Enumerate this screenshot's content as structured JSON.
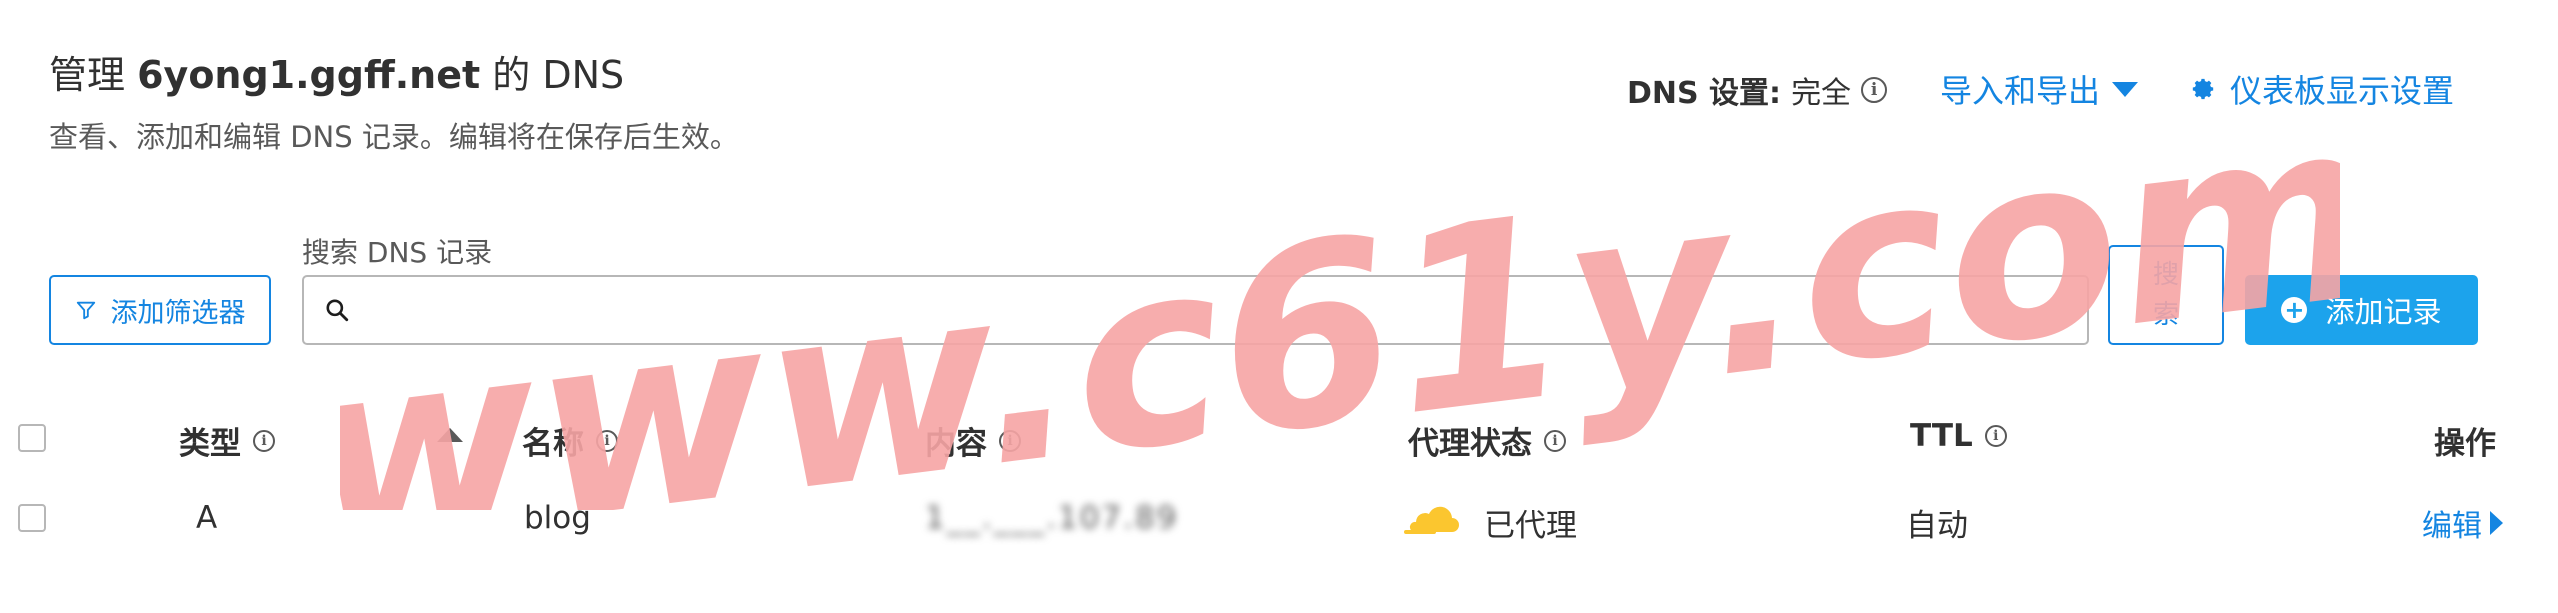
{
  "header": {
    "title_prefix": "管理",
    "domain": "6yong1.ggff.net",
    "title_suffix": "的 DNS",
    "subtitle": "查看、添加和编辑 DNS 记录。编辑将在保存后生效。"
  },
  "top_actions": {
    "dns_setting_label": "DNS 设置:",
    "dns_setting_value": "完全",
    "import_export": "导入和导出",
    "dashboard_settings": "仪表板显示设置"
  },
  "toolbar": {
    "filter_button": "添加筛选器",
    "search_label": "搜索 DNS 记录",
    "search_value": "",
    "search_button": "搜索",
    "add_button": "添加记录"
  },
  "table": {
    "columns": [
      "类型",
      "名称",
      "内容",
      "代理状态",
      "TTL",
      "操作"
    ],
    "rows": [
      {
        "type": "A",
        "name": "blog",
        "content": "1__.___.107.89",
        "proxy_status": "已代理",
        "ttl": "自动",
        "action": "编辑"
      }
    ]
  },
  "watermark": "www.c61y.com",
  "icons": {
    "info": "info-icon",
    "import_export_caret": "caret-down-icon",
    "dashboard": "gear-icon",
    "filter": "funnel-icon",
    "search": "search-icon",
    "add": "plus-circle-icon",
    "sort": "sort-ascending-icon",
    "proxy": "cloud-icon",
    "edit_caret": "caret-right-icon"
  },
  "colors": {
    "accent": "#1485e1",
    "primary_button": "#1ca3ec",
    "cloud": "#fbc62f",
    "watermark": "#f7a5a5"
  }
}
